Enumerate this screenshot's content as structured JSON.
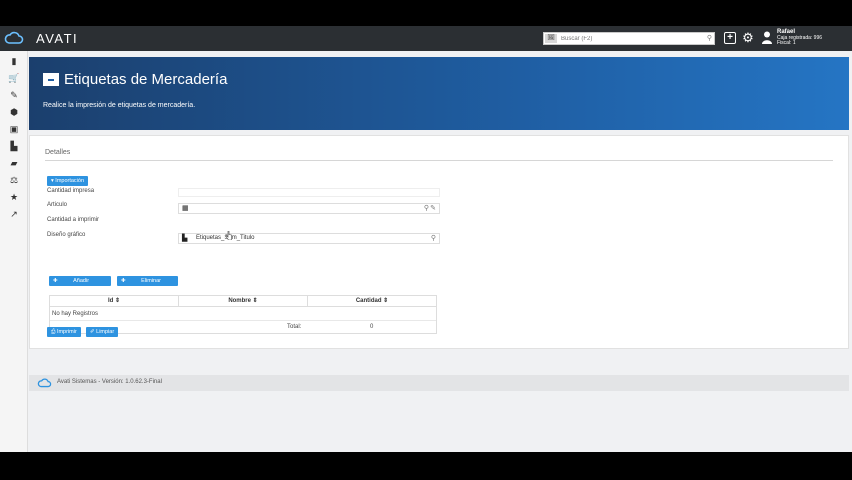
{
  "topbar": {
    "brand": "AVATI",
    "search_tag": "🖼",
    "search_placeholder": "Buscar (F2)",
    "user": {
      "name": "Rafael",
      "line2": "Caja registrada: 996",
      "line3": "Fiscal: 1"
    }
  },
  "sidebar": {
    "icons": [
      "book-icon",
      "cart-icon",
      "wrench-icon",
      "cubes-icon",
      "money-icon",
      "factory-icon",
      "truck-icon",
      "balance-icon",
      "star-icon",
      "chart-line-icon"
    ]
  },
  "header": {
    "title": "Etiquetas de Mercadería",
    "subtitle": "Realice la impresión de etiquetas de mercadería."
  },
  "form": {
    "section_title": "Detalles",
    "import_button": "▾ Importación",
    "labels": {
      "cantidad_impresa": "Cantidad impresa",
      "articulo": "Articulo",
      "cantidad_imprimir": "Cantidad a imprimir",
      "diseno": "Diseño gráfico"
    },
    "diseno_value": "Etiquetas_Sem_Titulo",
    "add_button": "Añadir",
    "remove_button": "Eliminar",
    "print_button": "Imprimir",
    "clear_button": "Limpiar"
  },
  "table": {
    "columns": [
      "Id ⇕",
      "Nombre ⇕",
      "Cantidad ⇕"
    ],
    "empty_text": "No hay Registros",
    "total_label": "Total:",
    "total_value": "0"
  },
  "footer": {
    "text": "Avati Sistemas - Versión: 1.0.62.3-Final"
  },
  "colors": {
    "topbar": "#2b2f33",
    "header_dark": "#1b3f6d",
    "header_light": "#2575c4",
    "button_blue": "#2e93e0"
  }
}
